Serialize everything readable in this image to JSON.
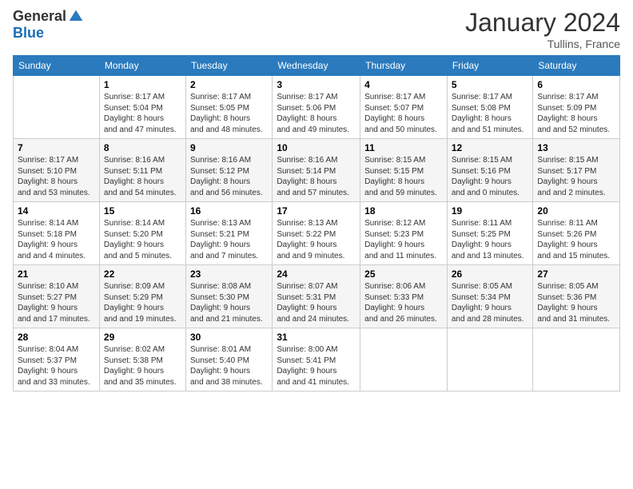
{
  "logo": {
    "general": "General",
    "blue": "Blue"
  },
  "title": "January 2024",
  "location": "Tullins, France",
  "days_of_week": [
    "Sunday",
    "Monday",
    "Tuesday",
    "Wednesday",
    "Thursday",
    "Friday",
    "Saturday"
  ],
  "weeks": [
    [
      {
        "day": "",
        "sunrise": "",
        "sunset": "",
        "daylight": ""
      },
      {
        "day": "1",
        "sunrise": "Sunrise: 8:17 AM",
        "sunset": "Sunset: 5:04 PM",
        "daylight": "Daylight: 8 hours and 47 minutes."
      },
      {
        "day": "2",
        "sunrise": "Sunrise: 8:17 AM",
        "sunset": "Sunset: 5:05 PM",
        "daylight": "Daylight: 8 hours and 48 minutes."
      },
      {
        "day": "3",
        "sunrise": "Sunrise: 8:17 AM",
        "sunset": "Sunset: 5:06 PM",
        "daylight": "Daylight: 8 hours and 49 minutes."
      },
      {
        "day": "4",
        "sunrise": "Sunrise: 8:17 AM",
        "sunset": "Sunset: 5:07 PM",
        "daylight": "Daylight: 8 hours and 50 minutes."
      },
      {
        "day": "5",
        "sunrise": "Sunrise: 8:17 AM",
        "sunset": "Sunset: 5:08 PM",
        "daylight": "Daylight: 8 hours and 51 minutes."
      },
      {
        "day": "6",
        "sunrise": "Sunrise: 8:17 AM",
        "sunset": "Sunset: 5:09 PM",
        "daylight": "Daylight: 8 hours and 52 minutes."
      }
    ],
    [
      {
        "day": "7",
        "sunrise": "Sunrise: 8:17 AM",
        "sunset": "Sunset: 5:10 PM",
        "daylight": "Daylight: 8 hours and 53 minutes."
      },
      {
        "day": "8",
        "sunrise": "Sunrise: 8:16 AM",
        "sunset": "Sunset: 5:11 PM",
        "daylight": "Daylight: 8 hours and 54 minutes."
      },
      {
        "day": "9",
        "sunrise": "Sunrise: 8:16 AM",
        "sunset": "Sunset: 5:12 PM",
        "daylight": "Daylight: 8 hours and 56 minutes."
      },
      {
        "day": "10",
        "sunrise": "Sunrise: 8:16 AM",
        "sunset": "Sunset: 5:14 PM",
        "daylight": "Daylight: 8 hours and 57 minutes."
      },
      {
        "day": "11",
        "sunrise": "Sunrise: 8:15 AM",
        "sunset": "Sunset: 5:15 PM",
        "daylight": "Daylight: 8 hours and 59 minutes."
      },
      {
        "day": "12",
        "sunrise": "Sunrise: 8:15 AM",
        "sunset": "Sunset: 5:16 PM",
        "daylight": "Daylight: 9 hours and 0 minutes."
      },
      {
        "day": "13",
        "sunrise": "Sunrise: 8:15 AM",
        "sunset": "Sunset: 5:17 PM",
        "daylight": "Daylight: 9 hours and 2 minutes."
      }
    ],
    [
      {
        "day": "14",
        "sunrise": "Sunrise: 8:14 AM",
        "sunset": "Sunset: 5:18 PM",
        "daylight": "Daylight: 9 hours and 4 minutes."
      },
      {
        "day": "15",
        "sunrise": "Sunrise: 8:14 AM",
        "sunset": "Sunset: 5:20 PM",
        "daylight": "Daylight: 9 hours and 5 minutes."
      },
      {
        "day": "16",
        "sunrise": "Sunrise: 8:13 AM",
        "sunset": "Sunset: 5:21 PM",
        "daylight": "Daylight: 9 hours and 7 minutes."
      },
      {
        "day": "17",
        "sunrise": "Sunrise: 8:13 AM",
        "sunset": "Sunset: 5:22 PM",
        "daylight": "Daylight: 9 hours and 9 minutes."
      },
      {
        "day": "18",
        "sunrise": "Sunrise: 8:12 AM",
        "sunset": "Sunset: 5:23 PM",
        "daylight": "Daylight: 9 hours and 11 minutes."
      },
      {
        "day": "19",
        "sunrise": "Sunrise: 8:11 AM",
        "sunset": "Sunset: 5:25 PM",
        "daylight": "Daylight: 9 hours and 13 minutes."
      },
      {
        "day": "20",
        "sunrise": "Sunrise: 8:11 AM",
        "sunset": "Sunset: 5:26 PM",
        "daylight": "Daylight: 9 hours and 15 minutes."
      }
    ],
    [
      {
        "day": "21",
        "sunrise": "Sunrise: 8:10 AM",
        "sunset": "Sunset: 5:27 PM",
        "daylight": "Daylight: 9 hours and 17 minutes."
      },
      {
        "day": "22",
        "sunrise": "Sunrise: 8:09 AM",
        "sunset": "Sunset: 5:29 PM",
        "daylight": "Daylight: 9 hours and 19 minutes."
      },
      {
        "day": "23",
        "sunrise": "Sunrise: 8:08 AM",
        "sunset": "Sunset: 5:30 PM",
        "daylight": "Daylight: 9 hours and 21 minutes."
      },
      {
        "day": "24",
        "sunrise": "Sunrise: 8:07 AM",
        "sunset": "Sunset: 5:31 PM",
        "daylight": "Daylight: 9 hours and 24 minutes."
      },
      {
        "day": "25",
        "sunrise": "Sunrise: 8:06 AM",
        "sunset": "Sunset: 5:33 PM",
        "daylight": "Daylight: 9 hours and 26 minutes."
      },
      {
        "day": "26",
        "sunrise": "Sunrise: 8:05 AM",
        "sunset": "Sunset: 5:34 PM",
        "daylight": "Daylight: 9 hours and 28 minutes."
      },
      {
        "day": "27",
        "sunrise": "Sunrise: 8:05 AM",
        "sunset": "Sunset: 5:36 PM",
        "daylight": "Daylight: 9 hours and 31 minutes."
      }
    ],
    [
      {
        "day": "28",
        "sunrise": "Sunrise: 8:04 AM",
        "sunset": "Sunset: 5:37 PM",
        "daylight": "Daylight: 9 hours and 33 minutes."
      },
      {
        "day": "29",
        "sunrise": "Sunrise: 8:02 AM",
        "sunset": "Sunset: 5:38 PM",
        "daylight": "Daylight: 9 hours and 35 minutes."
      },
      {
        "day": "30",
        "sunrise": "Sunrise: 8:01 AM",
        "sunset": "Sunset: 5:40 PM",
        "daylight": "Daylight: 9 hours and 38 minutes."
      },
      {
        "day": "31",
        "sunrise": "Sunrise: 8:00 AM",
        "sunset": "Sunset: 5:41 PM",
        "daylight": "Daylight: 9 hours and 41 minutes."
      },
      {
        "day": "",
        "sunrise": "",
        "sunset": "",
        "daylight": ""
      },
      {
        "day": "",
        "sunrise": "",
        "sunset": "",
        "daylight": ""
      },
      {
        "day": "",
        "sunrise": "",
        "sunset": "",
        "daylight": ""
      }
    ]
  ]
}
